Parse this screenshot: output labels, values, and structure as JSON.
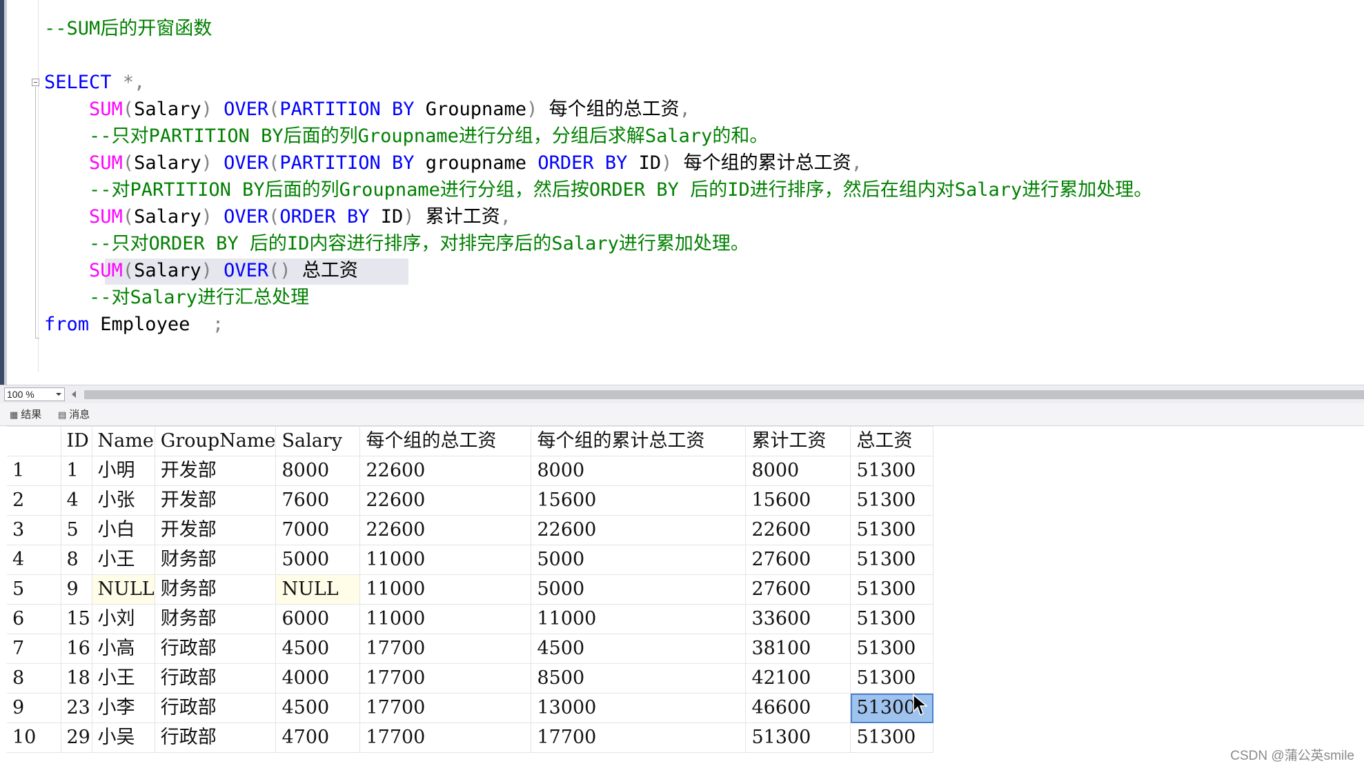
{
  "editor": {
    "lines": [
      {
        "name": "line-title-comment",
        "tokens": [
          {
            "t": "--SUM后的开窗函数",
            "c": "comment"
          }
        ]
      },
      {
        "name": "line-select",
        "tokens": [
          {
            "t": "SELECT",
            "c": "keyword"
          },
          {
            "t": " *,",
            "c": "gray"
          }
        ]
      },
      {
        "name": "line-sum-group",
        "tokens": [
          {
            "t": "    SUM",
            "c": "func"
          },
          {
            "t": "(",
            "c": "gray"
          },
          {
            "t": "Salary",
            "c": "ident"
          },
          {
            "t": ")",
            "c": "gray"
          },
          {
            "t": " OVER",
            "c": "keyword"
          },
          {
            "t": "(",
            "c": "gray"
          },
          {
            "t": "PARTITION BY",
            "c": "keyword"
          },
          {
            "t": " Groupname",
            "c": "ident"
          },
          {
            "t": ")",
            "c": "gray"
          },
          {
            "t": " 每个组的总工资",
            "c": "alias"
          },
          {
            "t": ",",
            "c": "gray"
          }
        ]
      },
      {
        "name": "line-comment-1",
        "tokens": [
          {
            "t": "    --只对PARTITION BY后面的列Groupname进行分组，分组后求解Salary的和。",
            "c": "comment"
          }
        ]
      },
      {
        "name": "line-sum-group-cumulative",
        "tokens": [
          {
            "t": "    SUM",
            "c": "func"
          },
          {
            "t": "(",
            "c": "gray"
          },
          {
            "t": "Salary",
            "c": "ident"
          },
          {
            "t": ")",
            "c": "gray"
          },
          {
            "t": " OVER",
            "c": "keyword"
          },
          {
            "t": "(",
            "c": "gray"
          },
          {
            "t": "PARTITION BY",
            "c": "keyword"
          },
          {
            "t": " groupname ",
            "c": "ident"
          },
          {
            "t": "ORDER BY",
            "c": "keyword"
          },
          {
            "t": " ID",
            "c": "ident"
          },
          {
            "t": ")",
            "c": "gray"
          },
          {
            "t": " 每个组的累计总工资",
            "c": "alias"
          },
          {
            "t": ",",
            "c": "gray"
          }
        ]
      },
      {
        "name": "line-comment-2",
        "tokens": [
          {
            "t": "    --对PARTITION BY后面的列Groupname进行分组，然后按ORDER BY 后的ID进行排序，然后在组内对Salary进行累加处理。",
            "c": "comment"
          }
        ]
      },
      {
        "name": "line-sum-cumulative",
        "tokens": [
          {
            "t": "    SUM",
            "c": "func"
          },
          {
            "t": "(",
            "c": "gray"
          },
          {
            "t": "Salary",
            "c": "ident"
          },
          {
            "t": ")",
            "c": "gray"
          },
          {
            "t": " OVER",
            "c": "keyword"
          },
          {
            "t": "(",
            "c": "gray"
          },
          {
            "t": "ORDER BY",
            "c": "keyword"
          },
          {
            "t": " ID",
            "c": "ident"
          },
          {
            "t": ")",
            "c": "gray"
          },
          {
            "t": " 累计工资",
            "c": "alias"
          },
          {
            "t": ",",
            "c": "gray"
          }
        ]
      },
      {
        "name": "line-comment-3",
        "tokens": [
          {
            "t": "    --只对ORDER BY 后的ID内容进行排序，对排完序后的Salary进行累加处理。",
            "c": "comment"
          }
        ]
      },
      {
        "name": "line-sum-total",
        "tokens": [
          {
            "t": "    SUM",
            "c": "func"
          },
          {
            "t": "(",
            "c": "gray"
          },
          {
            "t": "Salary",
            "c": "ident"
          },
          {
            "t": ")",
            "c": "gray"
          },
          {
            "t": " OVER",
            "c": "keyword"
          },
          {
            "t": "()",
            "c": "gray"
          },
          {
            "t": " 总工资",
            "c": "alias"
          }
        ]
      },
      {
        "name": "line-comment-4",
        "tokens": [
          {
            "t": "    --对Salary进行汇总处理",
            "c": "comment"
          }
        ]
      },
      {
        "name": "line-from",
        "tokens": [
          {
            "t": "from",
            "c": "keyword"
          },
          {
            "t": " Employee  ",
            "c": "ident"
          },
          {
            "t": ";",
            "c": "gray"
          }
        ]
      }
    ]
  },
  "zoom": {
    "value": "100 %"
  },
  "tabs": {
    "results": "结果",
    "messages": "消息"
  },
  "grid": {
    "columns": [
      "",
      "ID",
      "Name",
      "GroupName",
      "Salary",
      "每个组的总工资",
      "每个组的累计总工资",
      "累计工资",
      "总工资"
    ],
    "rows": [
      [
        "1",
        "1",
        "小明",
        "开发部",
        "8000",
        "22600",
        "8000",
        "8000",
        "51300"
      ],
      [
        "2",
        "4",
        "小张",
        "开发部",
        "7600",
        "22600",
        "15600",
        "15600",
        "51300"
      ],
      [
        "3",
        "5",
        "小白",
        "开发部",
        "7000",
        "22600",
        "22600",
        "22600",
        "51300"
      ],
      [
        "4",
        "8",
        "小王",
        "财务部",
        "5000",
        "11000",
        "5000",
        "27600",
        "51300"
      ],
      [
        "5",
        "9",
        "NULL",
        "财务部",
        "NULL",
        "11000",
        "5000",
        "27600",
        "51300"
      ],
      [
        "6",
        "15",
        "小刘",
        "财务部",
        "6000",
        "11000",
        "11000",
        "33600",
        "51300"
      ],
      [
        "7",
        "16",
        "小高",
        "行政部",
        "4500",
        "17700",
        "4500",
        "38100",
        "51300"
      ],
      [
        "8",
        "18",
        "小王",
        "行政部",
        "4000",
        "17700",
        "8500",
        "42100",
        "51300"
      ],
      [
        "9",
        "23",
        "小李",
        "行政部",
        "4500",
        "17700",
        "13000",
        "46600",
        "51300"
      ],
      [
        "10",
        "29",
        "小吴",
        "行政部",
        "4700",
        "17700",
        "17700",
        "51300",
        "51300"
      ]
    ],
    "selected_cell": {
      "row": 9,
      "col": 8
    }
  },
  "watermark": "CSDN @蒲公英smile"
}
